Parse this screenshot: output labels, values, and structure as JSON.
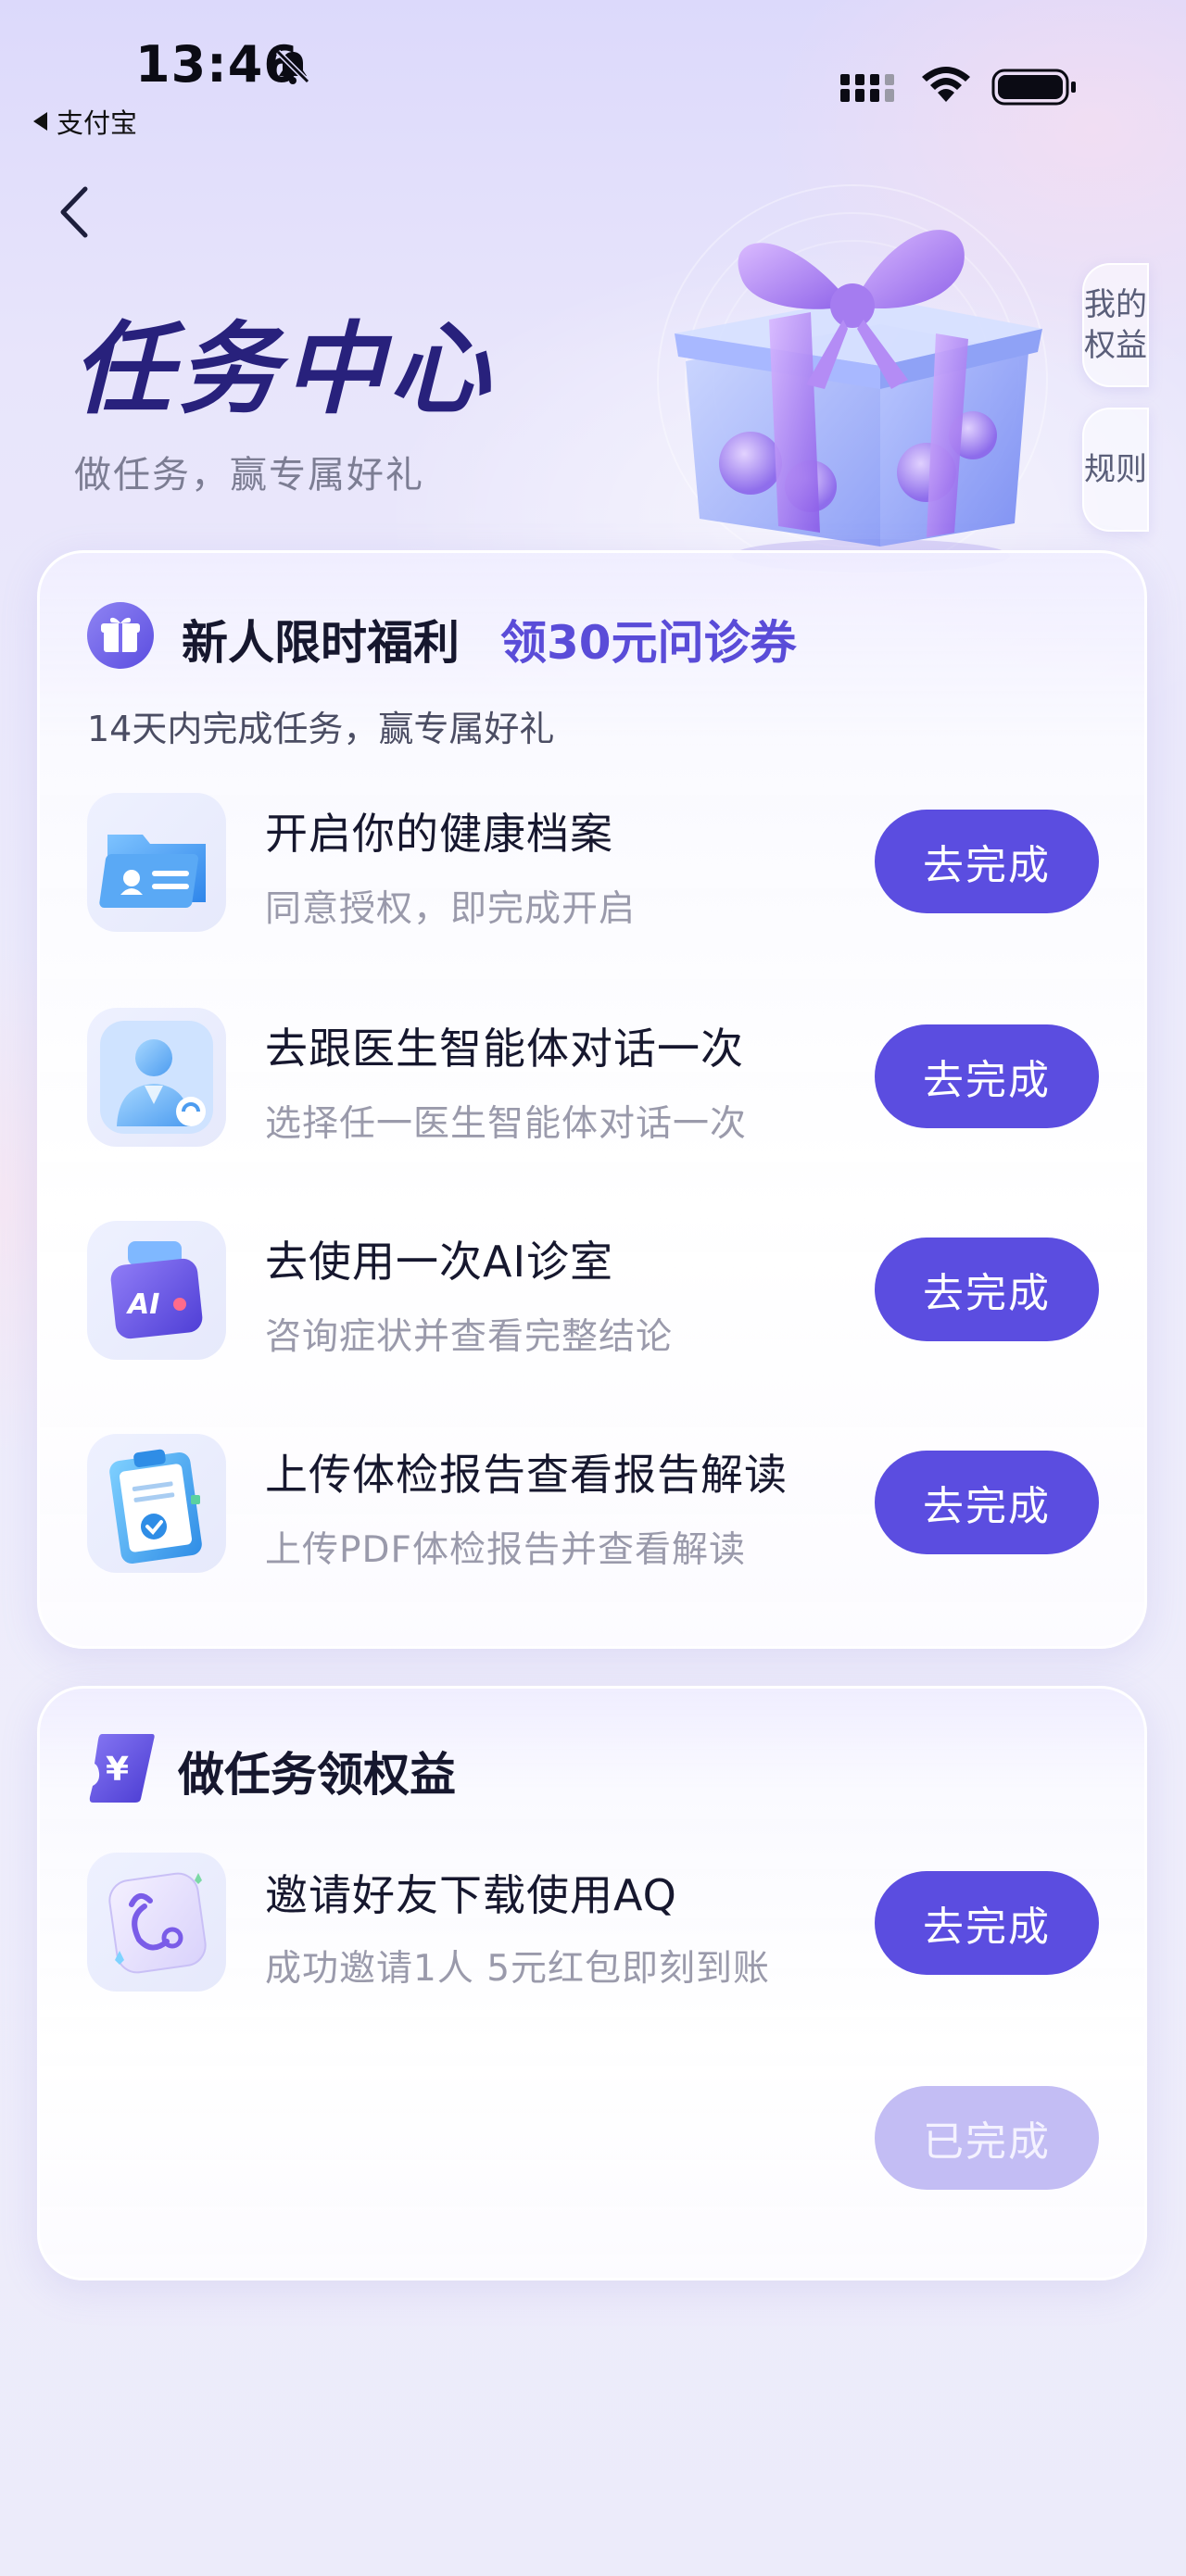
{
  "status_bar": {
    "time": "13:46",
    "back_app": "支付宝"
  },
  "header": {
    "title": "任务中心",
    "subtitle": "做任务，赢专属好礼",
    "side_tabs": {
      "my_rights": "我的\n权益",
      "rules": "规则"
    }
  },
  "newbie_card": {
    "title": "新人限时福利",
    "highlight": "领30元问诊券",
    "description": "14天内完成任务，赢专属好礼",
    "tasks": [
      {
        "title": "开启你的健康档案",
        "desc": "同意授权，即完成开启",
        "button": "去完成",
        "icon": "health-record-icon"
      },
      {
        "title": "去跟医生智能体对话一次",
        "desc": "选择任一医生智能体对话一次",
        "button": "去完成",
        "icon": "doctor-agent-icon"
      },
      {
        "title": "去使用一次AI诊室",
        "desc": "咨询症状并查看完整结论",
        "button": "去完成",
        "icon": "ai-clinic-icon"
      },
      {
        "title": "上传体检报告查看报告解读",
        "desc": "上传PDF体检报告并查看解读",
        "button": "去完成",
        "icon": "checkup-report-icon"
      }
    ]
  },
  "rights_card": {
    "title": "做任务领权益",
    "tasks": [
      {
        "title": "邀请好友下载使用AQ",
        "desc": "成功邀请1人 5元红包即刻到账",
        "button": "去完成",
        "icon": "invite-friend-icon"
      },
      {
        "title": "",
        "desc": "",
        "button": "已完成",
        "completed": true
      }
    ]
  },
  "colors": {
    "accent": "#5b4de0",
    "accent_done": "#c3bdf4",
    "title": "#28217c",
    "highlight": "#5a4cd8"
  }
}
